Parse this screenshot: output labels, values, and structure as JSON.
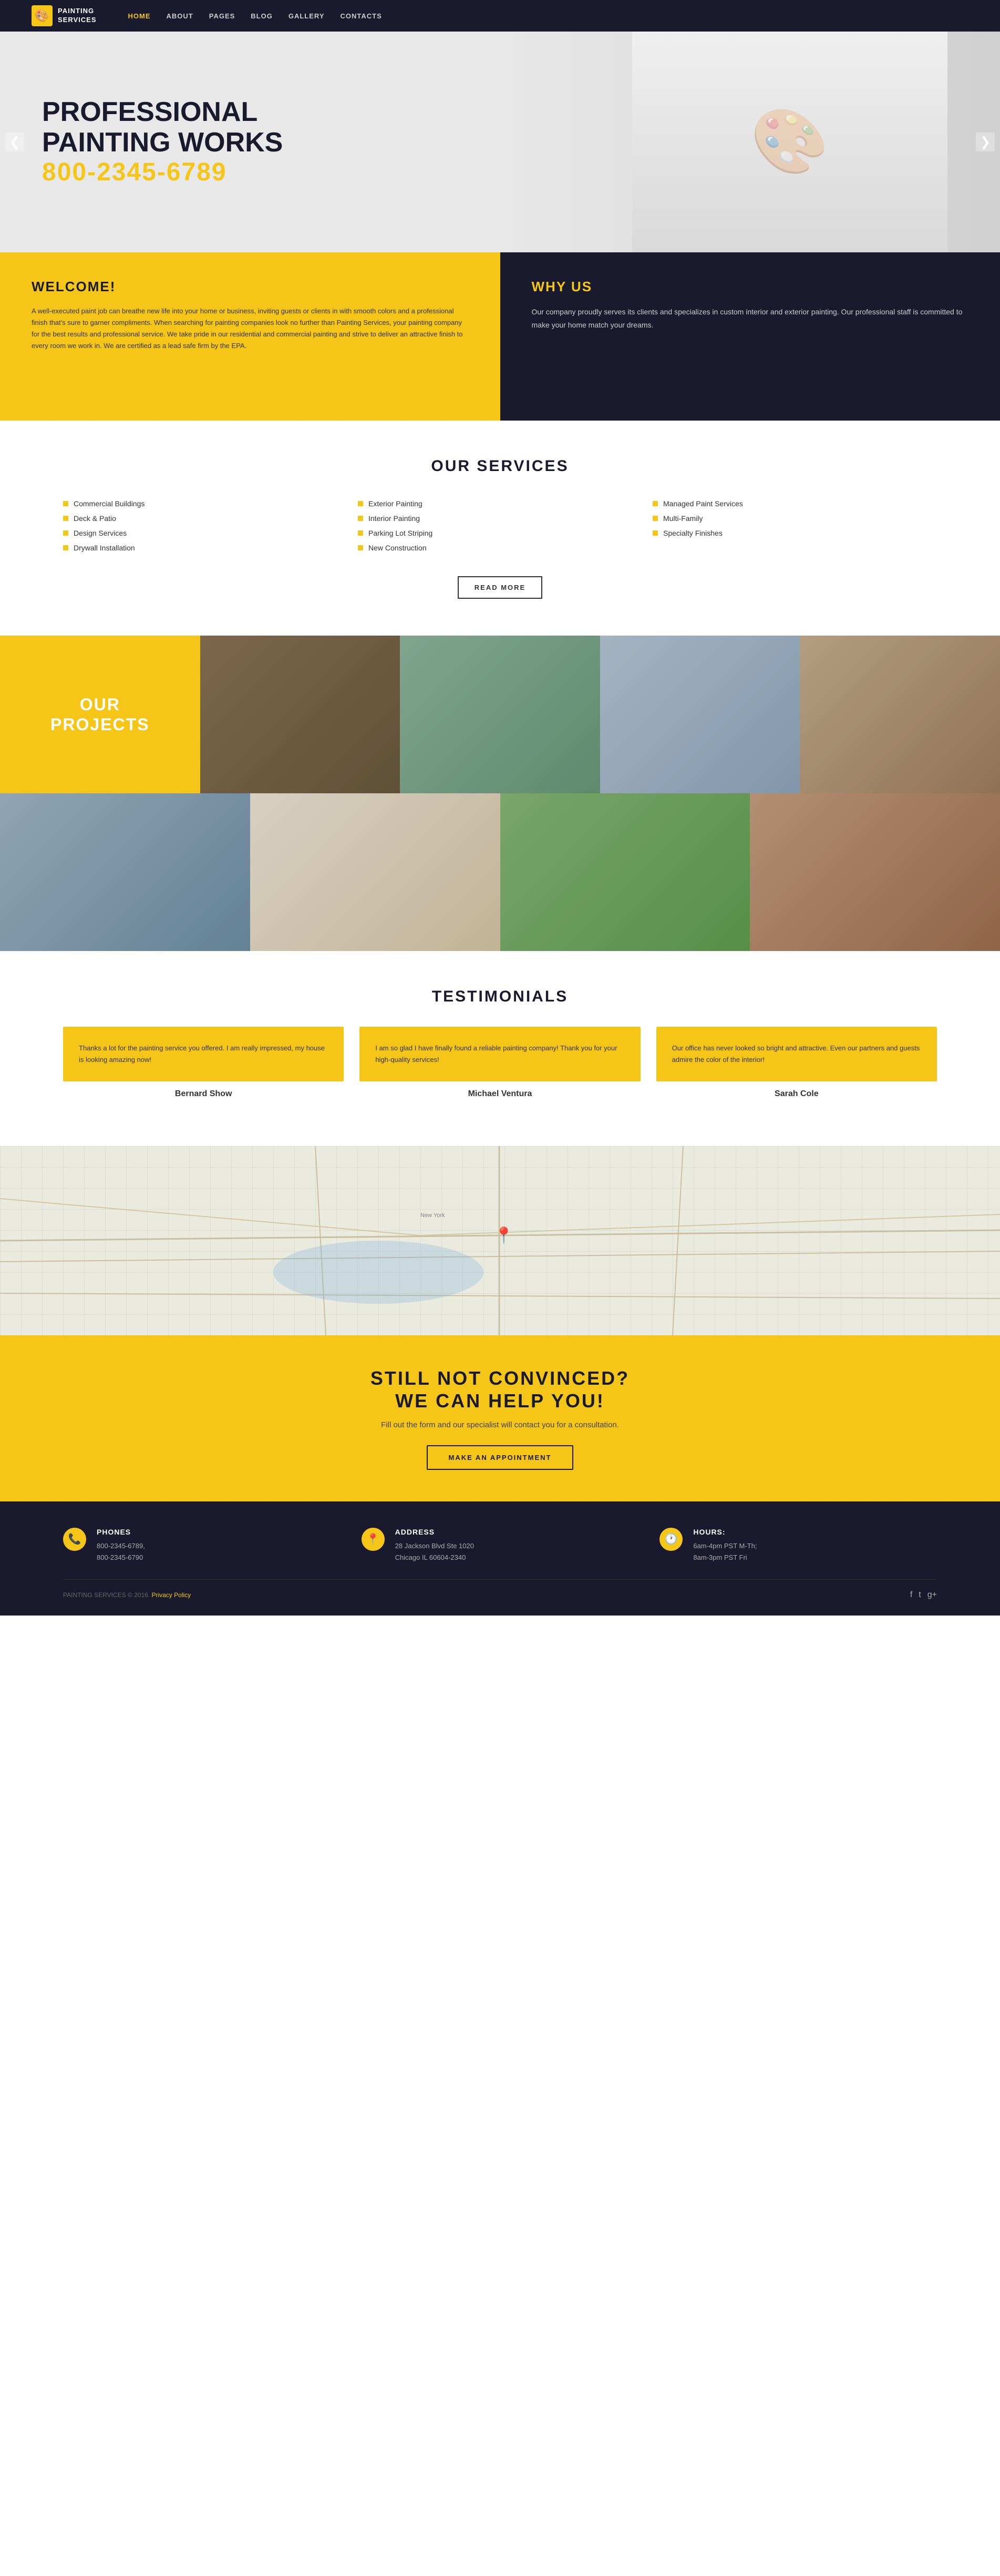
{
  "site": {
    "logo_icon": "🎨",
    "logo_line1": "PAINTING",
    "logo_line2": "SERVICES"
  },
  "nav": {
    "items": [
      {
        "label": "HOME",
        "active": true
      },
      {
        "label": "ABOUT",
        "active": false
      },
      {
        "label": "PAGES",
        "active": false
      },
      {
        "label": "BLOG",
        "active": false
      },
      {
        "label": "GALLERY",
        "active": false
      },
      {
        "label": "CONTACTS",
        "active": false
      }
    ]
  },
  "hero": {
    "line1": "PROFESSIONAL",
    "line2": "PAINTING WORKS",
    "phone": "800-2345-6789",
    "arrow_left": "❮",
    "arrow_right": "❯"
  },
  "welcome": {
    "title": "WELCOME!",
    "body": "A well-executed paint job can breathe new life into your home or business, inviting guests or clients in with smooth colors and a professional finish that's sure to garner compliments. When searching for painting companies look no further than Painting Services, your painting company for the best results and professional service. We take pride in our residential and commercial painting and strive to deliver an attractive finish to every room we work in. We are certified as a lead safe firm by the EPA."
  },
  "why_us": {
    "title": "WHY US",
    "body": "Our company proudly serves its clients and specializes in custom interior and exterior painting. Our professional staff is committed to make your home match your dreams."
  },
  "services": {
    "title": "OUR SERVICES",
    "read_more": "READ MORE",
    "items": [
      {
        "label": "Commercial Buildings"
      },
      {
        "label": "Deck & Patio"
      },
      {
        "label": "Design Services"
      },
      {
        "label": "Drywall Installation"
      },
      {
        "label": "Exterior Painting"
      },
      {
        "label": "Interior Painting"
      },
      {
        "label": "Parking Lot Striping"
      },
      {
        "label": "New Construction"
      },
      {
        "label": "Managed Paint Services"
      },
      {
        "label": "Multi-Family"
      },
      {
        "label": "Specialty Finishes"
      }
    ]
  },
  "projects": {
    "title_line1": "OUR",
    "title_line2": "PROJECTS"
  },
  "testimonials": {
    "title": "TESTIMONIALS",
    "items": [
      {
        "text": "Thanks a lot for the painting service you offered. I am really impressed, my house is looking amazing now!",
        "name": "Bernard Show"
      },
      {
        "text": "I am so glad I have finally found a reliable painting company! Thank you for your high-quality services!",
        "name": "Michael Ventura"
      },
      {
        "text": "Our office has never looked so bright and attractive. Even our partners and guests admire the color of the interior!",
        "name": "Sarah Cole"
      }
    ]
  },
  "map": {
    "pin": "📍",
    "label": "New York"
  },
  "cta": {
    "line1": "STILL NOT CONVINCED?",
    "line2": "WE CAN HELP YOU!",
    "body": "Fill out the form and our specialist will contact you for a consultation.",
    "button": "MAKE AN APPOINTMENT"
  },
  "footer": {
    "contacts": [
      {
        "icon": "📞",
        "title": "Phones",
        "lines": [
          "800-2345-6789,",
          "800-2345-6790"
        ]
      },
      {
        "icon": "📍",
        "title": "Address",
        "lines": [
          "28 Jackson Blvd Ste 1020",
          "Chicago IL 60604-2340"
        ]
      },
      {
        "icon": "🕐",
        "title": "Hours:",
        "lines": [
          "6am-4pm PST M-Th;",
          "8am-3pm PST Fri"
        ]
      }
    ],
    "copyright": "PAINTING SERVICES © 2016.",
    "privacy": "Privacy Policy",
    "social_icons": [
      "f",
      "t",
      "g+"
    ]
  }
}
